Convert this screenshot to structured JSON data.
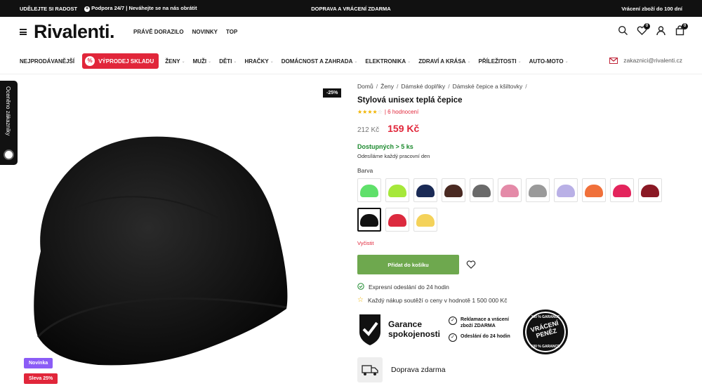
{
  "topbar": {
    "left1": "UDĚLEJTE SI RADOST",
    "support": "Podpora 24/7 | Neváhejte se na nás obrátit",
    "center": "DOPRAVA A VRÁCENÍ ZDARMA",
    "right": "Vrácení zboží do 100 dní"
  },
  "header": {
    "logo": "Rivalenti.",
    "nav": [
      "PRÁVĚ DORAZILO",
      "NOVINKY",
      "TOP"
    ],
    "wishlist_count": "0",
    "cart_count": "0"
  },
  "catnav": {
    "bestsellers": "NEJPRODÁVANĚJŠÍ",
    "sale": "VÝPRODEJ SKLADU",
    "sale_icon": "%",
    "items": [
      "ŽENY",
      "MUŽI",
      "DĚTI",
      "HRAČKY",
      "DOMÁCNOST A ZAHRADA",
      "ELEKTRONIKA",
      "ZDRAVÍ A KRÁSA",
      "PŘÍLEŽITOSTI",
      "AUTO-MOTO"
    ],
    "email": "zakaznici@rivalenti.cz"
  },
  "sidetab": {
    "label": "Oceněno zákazníky"
  },
  "gallery": {
    "discount_badge": "-25%",
    "label_new": "Novinka",
    "label_sale": "Sleva 25%"
  },
  "product": {
    "breadcrumb": [
      "Domů",
      "Ženy",
      "Dámské doplňky",
      "Dámské čepice a kšiltovky"
    ],
    "breadcrumb_sep": "/",
    "title": "Stylová unisex teplá čepice",
    "rating": 4,
    "rating_max": 5,
    "reviews": "6 hodnocení",
    "old_price": "212 Kč",
    "price": "159 Kč",
    "stock": "Dostupných > 5 ks",
    "ship_note": "Odesíláme každý pracovní den",
    "variant_label": "Barva",
    "swatches": [
      {
        "color": "#5fe06a",
        "selected": false
      },
      {
        "color": "#a6e83a",
        "selected": false
      },
      {
        "color": "#1a2a55",
        "selected": false
      },
      {
        "color": "#4a2a22",
        "selected": false
      },
      {
        "color": "#6a6a6a",
        "selected": false
      },
      {
        "color": "#e48aa8",
        "selected": false
      },
      {
        "color": "#9a9a9a",
        "selected": false
      },
      {
        "color": "#b9b0e6",
        "selected": false
      },
      {
        "color": "#f0703a",
        "selected": false
      },
      {
        "color": "#e3245c",
        "selected": false
      },
      {
        "color": "#8a1824",
        "selected": false
      },
      {
        "color": "#111111",
        "selected": true
      },
      {
        "color": "#dc2a3e",
        "selected": false
      },
      {
        "color": "#f4d25a",
        "selected": false
      }
    ],
    "clear": "Vyčistit",
    "add_to_cart": "Přidat do košíku",
    "feature1": "Expresní odeslání do 24 hodin",
    "feature2": "Každý nákup soutěží o ceny v hodnotě 1 500 000 Kč",
    "guarantee": {
      "line1": "Garance",
      "line2": "spokojenosti"
    },
    "check1": {
      "line1": "Reklamace a vrácení",
      "line2": "zboží ZDARMA"
    },
    "check2": {
      "line1": "Odeslání do 24 hodin"
    },
    "stamp": {
      "top": "100 % GARANCE",
      "main1": "VRÁCENÍ",
      "main2": "PENĚZ",
      "bottom": "100 % GARANCE"
    },
    "delivery": "Doprava zdarma"
  },
  "colors": {
    "accent_red": "#e1263a",
    "cart_green": "#6ea84e",
    "stock_green": "#1c8a2e",
    "star": "#f0b400"
  }
}
